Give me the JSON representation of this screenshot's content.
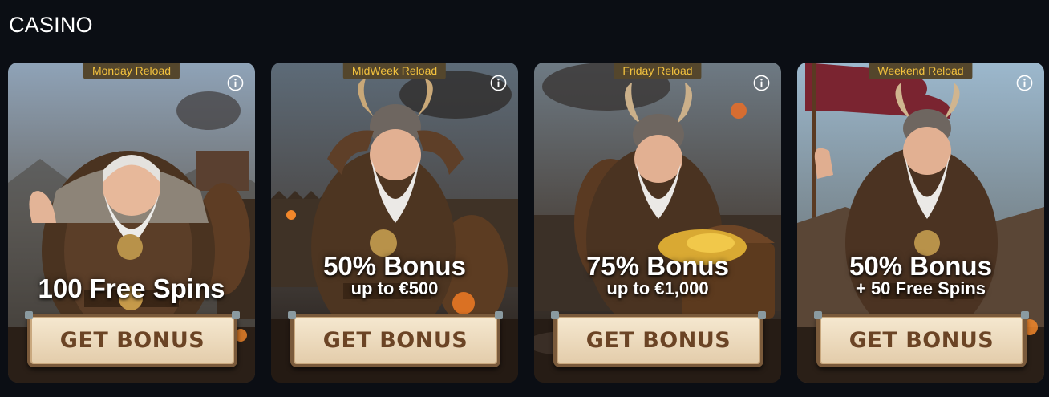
{
  "section": {
    "title": "CASINO"
  },
  "colors": {
    "page_bg": "#0b0e14",
    "tag_bg": "#54462c",
    "tag_text": "#f3c23e",
    "button_text": "#6b4425"
  },
  "cards": [
    {
      "tag": "Monday Reload",
      "headline": "100 Free Spins",
      "subline": "",
      "button": "GET BONUS",
      "info_icon": "info-circle-icon"
    },
    {
      "tag": "MidWeek Reload",
      "headline": "50% Bonus",
      "subline": "up to €500",
      "button": "GET BONUS",
      "info_icon": "info-circle-icon"
    },
    {
      "tag": "Friday Reload",
      "headline": "75% Bonus",
      "subline": "up to €1,000",
      "button": "GET BONUS",
      "info_icon": "info-circle-icon"
    },
    {
      "tag": "Weekend Reload",
      "headline": "50% Bonus",
      "subline": "+ 50 Free Spins",
      "button": "GET BONUS",
      "info_icon": "info-circle-icon"
    }
  ]
}
